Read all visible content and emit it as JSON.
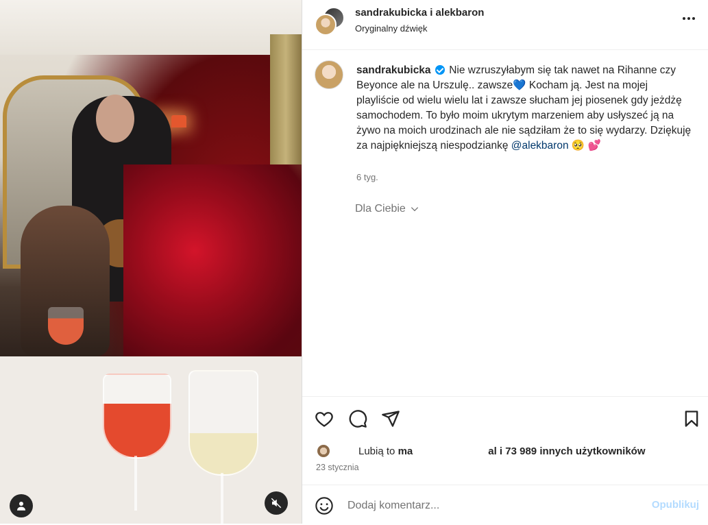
{
  "post": {
    "header": {
      "owners": "sandrakubicka i alekbaron",
      "audio": "Oryginalny dźwięk",
      "more_icon": "more-horizontal-icon"
    },
    "caption": {
      "username": "sandrakubicka",
      "verified": true,
      "text_part1": "Nie wzruszyłabym się tak nawet na Rihanne czy Beyonce ale na Urszulę.. zawsze",
      "emoji_heart_blue": "💙",
      "text_part2": " Kocham ją. Jest na mojej playliście od wielu wielu lat i zawsze słucham jej piosenek gdy jeżdżę samochodem. To było moim ukrytym marzeniem aby usłyszeć ją na żywo na moich urodzinach ale nie sądziłam że to się wydarzy. Dziękuję za najpiękniejszą niespodziankę",
      "mention": "@alekbaron",
      "emoji_end": "🥺 💕",
      "time": "6 tyg."
    },
    "for_you": "Dla Ciebie",
    "likes": {
      "prefix": "Lubią to",
      "user_partial": "ma",
      "user_partial2": "al",
      "suffix": " i 73 989 innych użytkowników"
    },
    "date": "23 stycznia",
    "comment": {
      "placeholder": "Dodaj komentarz...",
      "publish": "Opublikuj"
    }
  },
  "colors": {
    "verified": "#0095f6",
    "mention": "#00376b",
    "publish_disabled": "#b3dbff",
    "muted_text": "#737373"
  }
}
